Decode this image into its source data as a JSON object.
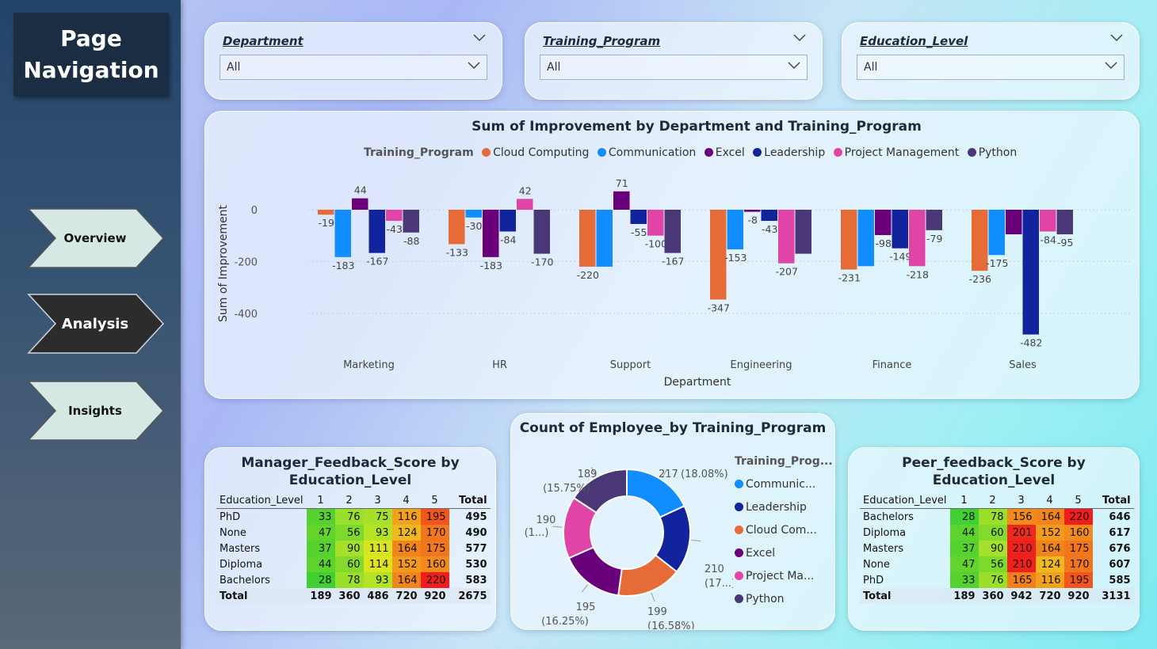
{
  "nav": {
    "title_line1": "Page",
    "title_line2": "Navigation",
    "buttons": [
      {
        "label": "Overview",
        "active": false
      },
      {
        "label": "Analysis",
        "active": true
      },
      {
        "label": "Insights",
        "active": false
      }
    ]
  },
  "slicers": [
    {
      "title": "Department",
      "value": "All"
    },
    {
      "title": "Training_Program",
      "value": "All"
    },
    {
      "title": "Education_Level",
      "value": "All"
    }
  ],
  "colors": {
    "Cloud Computing": "#e66c37",
    "Communication": "#118dff",
    "Excel": "#6b007b",
    "Leadership": "#12239e",
    "Project Management": "#e044a7",
    "Python": "#4a3778"
  },
  "bar_chart": {
    "title": "Sum of Improvement by Department and Training_Program",
    "legend_title": "Training_Program",
    "chart_data": {
      "type": "bar",
      "title": "Sum of Improvement by Department and Training_Program",
      "xlabel": "Department",
      "ylabel": "Sum of Improvement",
      "ylim": [
        -482,
        71
      ],
      "yticks": [
        0,
        -200,
        -400
      ],
      "categories": [
        "Marketing",
        "HR",
        "Support",
        "Engineering",
        "Finance",
        "Sales"
      ],
      "series": [
        {
          "name": "Cloud Computing",
          "values": [
            -19,
            -133,
            -220,
            -347,
            -231,
            -236
          ]
        },
        {
          "name": "Communication",
          "values": [
            -183,
            -30,
            -220,
            -153,
            -218,
            -175
          ]
        },
        {
          "name": "Excel",
          "values": [
            44,
            -183,
            71,
            -8,
            -98,
            -95
          ]
        },
        {
          "name": "Leadership",
          "values": [
            -167,
            -84,
            -55,
            -43,
            -149,
            -482
          ]
        },
        {
          "name": "Project Management",
          "values": [
            -43,
            42,
            -100,
            -207,
            -218,
            -84
          ]
        },
        {
          "name": "Python",
          "values": [
            -88,
            -170,
            -167,
            -170,
            -79,
            -95
          ]
        }
      ],
      "data_labels": [
        [
          "-19",
          "-183",
          "44",
          "-167",
          "-43",
          "-88"
        ],
        [
          "-133",
          "-30",
          "-183",
          "-84",
          "42",
          "-170"
        ],
        [
          "-220",
          "",
          "71",
          "-55",
          "-100",
          "-167"
        ],
        [
          "-347",
          "-153",
          "-8",
          "-43",
          "-207",
          ""
        ],
        [
          "-231",
          "",
          "-98",
          "-149",
          "-218",
          "-79"
        ],
        [
          "-236",
          "-175",
          "",
          "-482",
          "-84",
          "-95"
        ]
      ],
      "legend_position": "top",
      "grid": true
    }
  },
  "donut": {
    "title": "Count of Employee_by Training_Program",
    "legend_title": "Training_Prog...",
    "legend_items": [
      "Communic...",
      "Leadership",
      "Cloud Com...",
      "Excel",
      "Project Ma...",
      "Python"
    ],
    "chart_data": {
      "type": "pie",
      "title": "Count of Employee_by Training_Program",
      "categories": [
        "Communication",
        "Leadership",
        "Cloud Computing",
        "Excel",
        "Project Management",
        "Python"
      ],
      "values": [
        217,
        210,
        199,
        195,
        190,
        189
      ],
      "labels": [
        [
          "217",
          "(18.08%)"
        ],
        [
          "210",
          "(17...)"
        ],
        [
          "199",
          "(16.58%)"
        ],
        [
          "195",
          "(16.25%)"
        ],
        [
          "190",
          "(1...)"
        ],
        [
          "189",
          "(15.75%)"
        ]
      ]
    }
  },
  "manager_matrix": {
    "title_line1": "Manager_Feedback_Score by",
    "title_line2": "Education_Level",
    "headers": [
      "Education_Level",
      "1",
      "2",
      "3",
      "4",
      "5",
      "Total"
    ],
    "rows": [
      {
        "label": "PhD",
        "values": [
          "33",
          "76",
          "75",
          "116",
          "195"
        ],
        "colors": [
          "#55d230",
          "#9ae02a",
          "#a6e02a",
          "#f2a11c",
          "#f2561c"
        ],
        "total": "495"
      },
      {
        "label": "None",
        "values": [
          "47",
          "56",
          "93",
          "124",
          "170"
        ],
        "colors": [
          "#61d42e",
          "#7bda2c",
          "#b4e224",
          "#f0b81e",
          "#f2761c"
        ],
        "total": "490"
      },
      {
        "label": "Masters",
        "values": [
          "37",
          "90",
          "111",
          "164",
          "175"
        ],
        "colors": [
          "#55d230",
          "#a6e02a",
          "#d8e41e",
          "#f2841c",
          "#f2761c"
        ],
        "total": "577"
      },
      {
        "label": "Diploma",
        "values": [
          "44",
          "60",
          "114",
          "152",
          "160"
        ],
        "colors": [
          "#5dd42e",
          "#84da2c",
          "#dce41e",
          "#f29a1c",
          "#f28a1c"
        ],
        "total": "530"
      },
      {
        "label": "Bachelors",
        "values": [
          "28",
          "78",
          "93",
          "164",
          "220"
        ],
        "colors": [
          "#3fd032",
          "#9ae02a",
          "#b4e224",
          "#f2841c",
          "#f21c1c"
        ],
        "total": "583"
      }
    ],
    "total_label": "Total",
    "totals": [
      "189",
      "360",
      "486",
      "720",
      "920"
    ],
    "grand_total": "2675"
  },
  "peer_matrix": {
    "title_line1": "Peer_feedback_Score by",
    "title_line2": "Education_Level",
    "headers": [
      "Education_Level",
      "1",
      "2",
      "3",
      "4",
      "5",
      "Total"
    ],
    "rows": [
      {
        "label": "Bachelors",
        "values": [
          "28",
          "78",
          "156",
          "164",
          "220"
        ],
        "colors": [
          "#3fd032",
          "#9ae02a",
          "#f28a1c",
          "#f2841c",
          "#f21c1c"
        ],
        "total": "646"
      },
      {
        "label": "Diploma",
        "values": [
          "44",
          "60",
          "201",
          "152",
          "160"
        ],
        "colors": [
          "#5dd42e",
          "#84da2c",
          "#f2281c",
          "#f29a1c",
          "#f28a1c"
        ],
        "total": "617"
      },
      {
        "label": "Masters",
        "values": [
          "37",
          "90",
          "210",
          "164",
          "175"
        ],
        "colors": [
          "#55d230",
          "#a6e02a",
          "#f2201c",
          "#f2841c",
          "#f2761c"
        ],
        "total": "676"
      },
      {
        "label": "None",
        "values": [
          "47",
          "56",
          "210",
          "124",
          "170"
        ],
        "colors": [
          "#61d42e",
          "#7bda2c",
          "#f2201c",
          "#f0b81e",
          "#f2761c"
        ],
        "total": "607"
      },
      {
        "label": "PhD",
        "values": [
          "33",
          "76",
          "165",
          "116",
          "195"
        ],
        "colors": [
          "#55d230",
          "#9ae02a",
          "#f2801c",
          "#f2a11c",
          "#f2561c"
        ],
        "total": "585"
      }
    ],
    "total_label": "Total",
    "totals": [
      "189",
      "360",
      "942",
      "720",
      "920"
    ],
    "grand_total": "3131"
  }
}
